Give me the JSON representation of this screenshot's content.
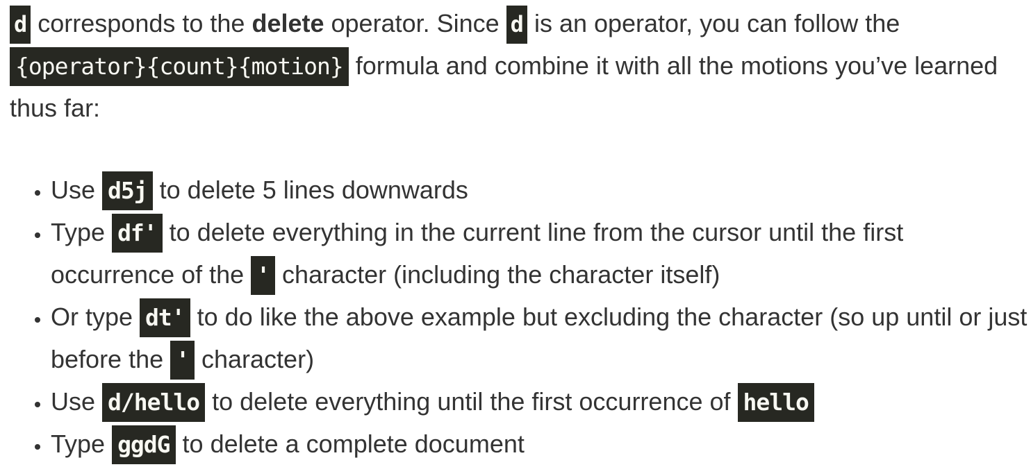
{
  "intro": {
    "code_d": "d",
    "t1": " corresponds to the ",
    "bold": "delete",
    "t2": " operator. Since ",
    "t3": " is an operator, you can follow the ",
    "formula": "{operator}{count}{motion}",
    "t4": " formula and combine it with all the motions you’ve learned thus far:"
  },
  "items": [
    {
      "pre": "Use ",
      "code": "d5j",
      "post": " to delete 5 lines downwards"
    },
    {
      "pre": "Type ",
      "code": "df'",
      "post": " to delete everything in the current line from the cursor until the first occurrence of the ",
      "code2": "'",
      "post2": " character (including the character itself)"
    },
    {
      "pre": "Or type ",
      "code": "dt'",
      "post": " to do like the above example but excluding the character (so up until or just before the ",
      "code2": "'",
      "post2": " character)"
    },
    {
      "pre": "Use ",
      "code": "d/hello",
      "post": " to delete everything until the first occurrence of ",
      "code2": "hello",
      "post2": ""
    },
    {
      "pre": "Type ",
      "code": "ggdG",
      "post": " to delete a complete document"
    }
  ],
  "colors": {
    "text": "#333333",
    "code_bg": "#272822",
    "code_fg": "#f8f8f2"
  }
}
